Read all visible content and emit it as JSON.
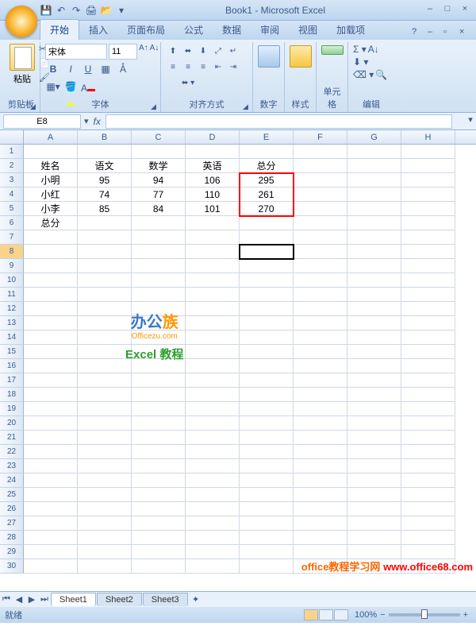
{
  "title": "Book1 - Microsoft Excel",
  "qat": {
    "save": "💾",
    "undo": "↶",
    "redo": "↷",
    "print": "🖨",
    "open": "📂"
  },
  "tabs": {
    "items": [
      "开始",
      "插入",
      "页面布局",
      "公式",
      "数据",
      "审阅",
      "视图",
      "加载项"
    ],
    "active": 0
  },
  "ribbon": {
    "clipboard": {
      "label": "剪贴板",
      "paste": "粘贴"
    },
    "font": {
      "label": "字体",
      "name": "宋体",
      "size": "11",
      "bold": "B",
      "italic": "I",
      "underline": "U"
    },
    "alignment": {
      "label": "对齐方式"
    },
    "number": {
      "label": "数字"
    },
    "styles": {
      "label": "样式"
    },
    "cells": {
      "label": "单元格"
    },
    "editing": {
      "label": "编辑"
    }
  },
  "namebox": "E8",
  "columns": [
    "A",
    "B",
    "C",
    "D",
    "E",
    "F",
    "G",
    "H"
  ],
  "rows_count": 30,
  "data": {
    "r2": {
      "A": "姓名",
      "B": "语文",
      "C": "数学",
      "D": "英语",
      "E": "总分"
    },
    "r3": {
      "A": "小明",
      "B": "95",
      "C": "94",
      "D": "106",
      "E": "295"
    },
    "r4": {
      "A": "小红",
      "B": "74",
      "C": "77",
      "D": "110",
      "E": "261"
    },
    "r5": {
      "A": "小李",
      "B": "85",
      "C": "84",
      "D": "101",
      "E": "270"
    },
    "r6": {
      "A": "总分"
    }
  },
  "selected_cell": {
    "row": 8,
    "col": "E"
  },
  "red_highlight": {
    "from_row": 3,
    "to_row": 5,
    "col": "E"
  },
  "watermark": {
    "line1a": "办公",
    "line1b": "族",
    "line2": "Officezu.com",
    "line3": "Excel 教程"
  },
  "sheets": {
    "items": [
      "Sheet1",
      "Sheet2",
      "Sheet3"
    ],
    "active": 0
  },
  "status": {
    "ready": "就绪",
    "zoom": "100%"
  },
  "site": {
    "a": "office教程学习网",
    "b": "www.office68.com"
  }
}
